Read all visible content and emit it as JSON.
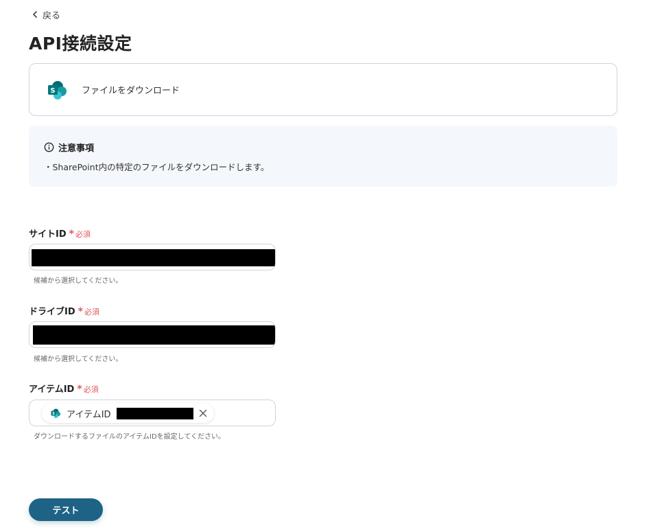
{
  "nav": {
    "back_label": "戻る"
  },
  "page": {
    "title": "API接続設定"
  },
  "action": {
    "label": "ファイルをダウンロード",
    "app_icon": "sharepoint-icon"
  },
  "notice": {
    "title": "注意事項",
    "body": "・SharePoint内の特定のファイルをダウンロードします。"
  },
  "fields": {
    "required_label": "必須",
    "site_id": {
      "label": "サイトID",
      "hint": "候補から選択してください。"
    },
    "drive_id": {
      "label": "ドライブID",
      "hint": "候補から選択してください。"
    },
    "item_id": {
      "label": "アイテムID",
      "chip_label": "アイテムID",
      "hint": "ダウンロードするファイルのアイテムIDを設定してください。"
    }
  },
  "footer": {
    "test_button": "テスト"
  },
  "colors": {
    "primary": "#1e6385",
    "required": "#e0565b",
    "notice_bg": "#f4f7fb",
    "sharepoint": "#038387"
  }
}
